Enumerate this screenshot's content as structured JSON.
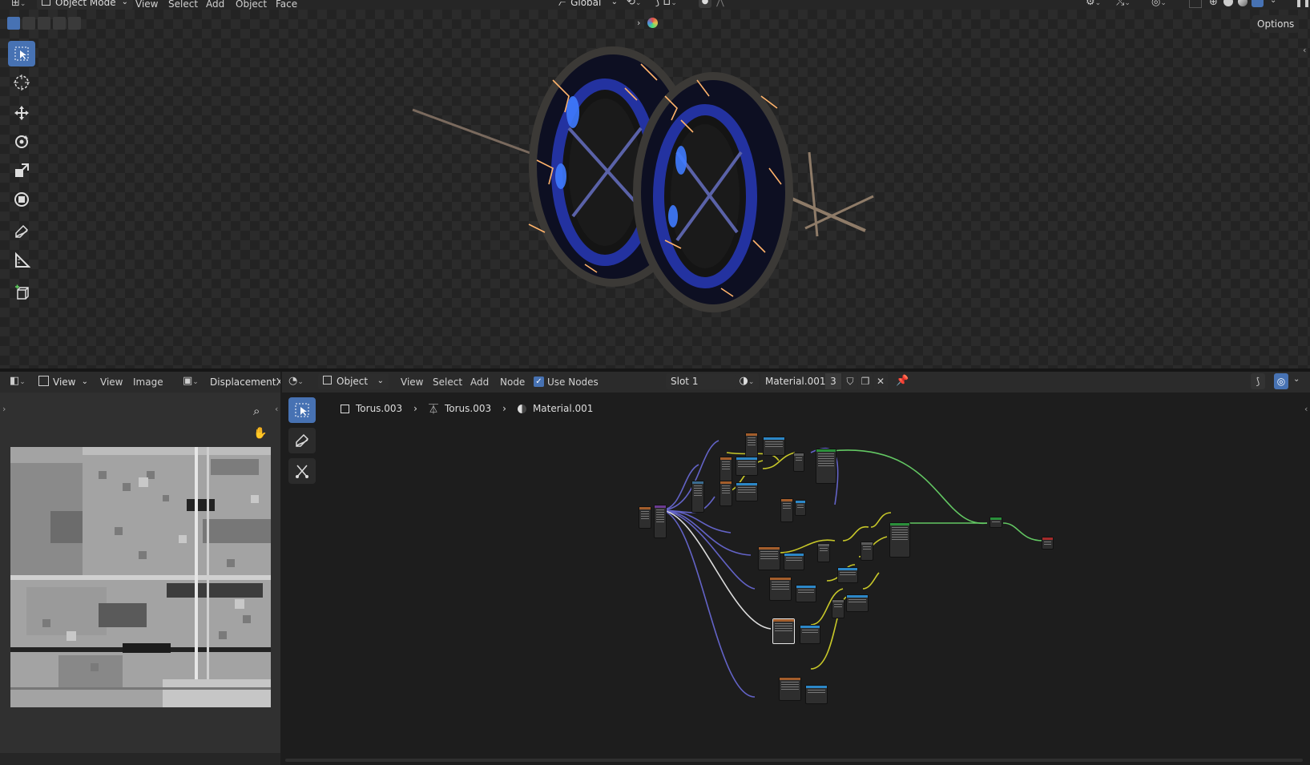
{
  "top_header": {
    "mode": "Object Mode",
    "menus": [
      "View",
      "Select",
      "Add",
      "Object",
      "Face"
    ],
    "orientation": "Global",
    "options_label": "Options"
  },
  "viewport": {
    "tools": [
      "select-box",
      "cursor",
      "move",
      "rotate",
      "scale",
      "transform",
      "annotate",
      "measure",
      "add-cube"
    ]
  },
  "image_editor": {
    "view_dropdown": "View",
    "menus": [
      "View",
      "Image"
    ],
    "image_name": "DisplacementX_"
  },
  "node_editor": {
    "object_dropdown": "Object",
    "menus": [
      "View",
      "Select",
      "Add",
      "Node"
    ],
    "use_nodes_label": "Use Nodes",
    "use_nodes_checked": true,
    "slot": "Slot 1",
    "material_name": "Material.001",
    "material_users": "3",
    "breadcrumb": {
      "object": "Torus.003",
      "mesh": "Torus.003",
      "material": "Material.001"
    }
  },
  "colors": {
    "accent": "#4772b3",
    "link_purple": "#6363c7",
    "link_yellow": "#c7c729",
    "link_green": "#63c763",
    "header_bg": "#303030",
    "editor_bg": "#1d1d1d"
  }
}
